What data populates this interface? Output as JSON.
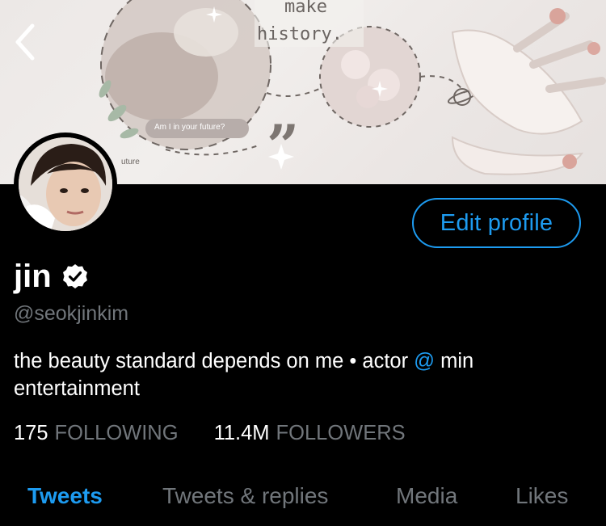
{
  "banner": {
    "text_line1": "make",
    "text_line2": "history.",
    "caption": "Am I in your future?",
    "caption_fragment": "uture"
  },
  "nav": {
    "back_icon": "chevron-left-icon"
  },
  "profile": {
    "name": "jin",
    "verified_icon": "verified-badge-icon",
    "handle": "@seokjinkim",
    "bio_part1": "the beauty standard depends on me • actor ",
    "bio_mention": "@",
    "bio_part2": " min entertainment",
    "edit_button": "Edit profile"
  },
  "stats": {
    "following_count": "175",
    "following_label": "FOLLOWING",
    "followers_count": "11.4M",
    "followers_label": "FOLLOWERS"
  },
  "tabs": [
    {
      "label": "Tweets",
      "active": true
    },
    {
      "label": "Tweets & replies",
      "active": false
    },
    {
      "label": "Media",
      "active": false
    },
    {
      "label": "Likes",
      "active": false
    }
  ],
  "colors": {
    "accent": "#1d9bf0",
    "secondary_text": "#71767b",
    "background": "#000000"
  }
}
